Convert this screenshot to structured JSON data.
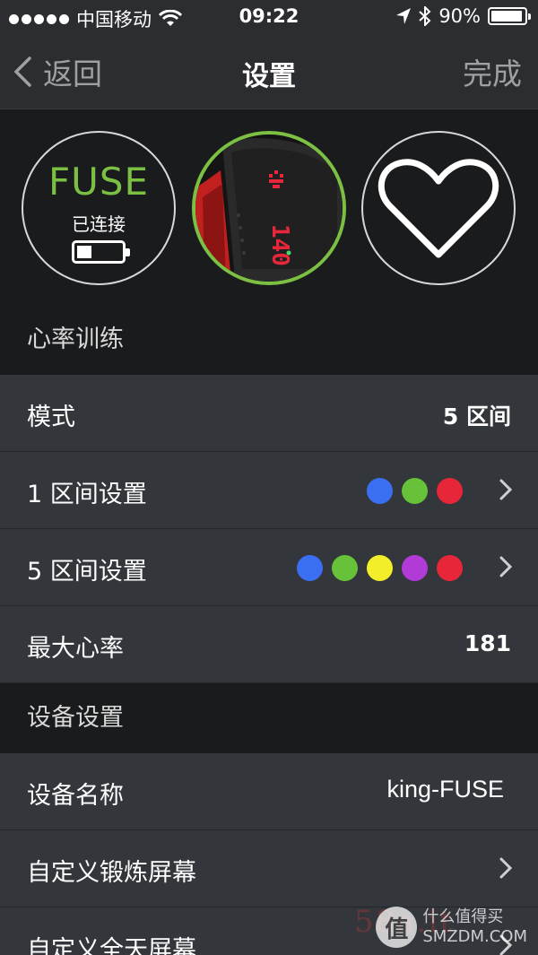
{
  "status_bar": {
    "carrier": "中国移动",
    "time": "09:22",
    "battery": "90%",
    "icons": [
      "signal-dots-icon",
      "wifi-icon",
      "location-arrow-icon",
      "bluetooth-icon",
      "battery-icon"
    ]
  },
  "nav": {
    "back_label": "返回",
    "title": "设置",
    "done_label": "完成"
  },
  "devices": {
    "fuse_name": "FUSE",
    "fuse_status": "已连接",
    "band_display": "140"
  },
  "colors": {
    "accent_green": "#7bc043",
    "row_bg": "#33363b",
    "section_bg": "#1a1b1d"
  },
  "sections": {
    "heart_training": {
      "header": "心率训练",
      "mode_label": "模式",
      "mode_value": "5 区间",
      "zone1_label": "1 区间设置",
      "zone1_colors": [
        "#3a6ff2",
        "#67c23a",
        "#e8263a"
      ],
      "zone5_label": "5 区间设置",
      "zone5_colors": [
        "#3a6ff2",
        "#67c23a",
        "#f2ee2a",
        "#b23ad6",
        "#e8263a"
      ],
      "max_hr_label": "最大心率",
      "max_hr_value": "181"
    },
    "device_settings": {
      "header": "设备设置",
      "name_label": "设备名称",
      "name_value": "king-FUSE",
      "workout_screen_label": "自定义锻炼屏幕",
      "allday_screen_label": "自定义全天屏幕"
    }
  },
  "watermark": {
    "logo_char": "值",
    "line1": "什么值得买",
    "line2": "SMZDM.COM",
    "ghost": "58a.it"
  }
}
